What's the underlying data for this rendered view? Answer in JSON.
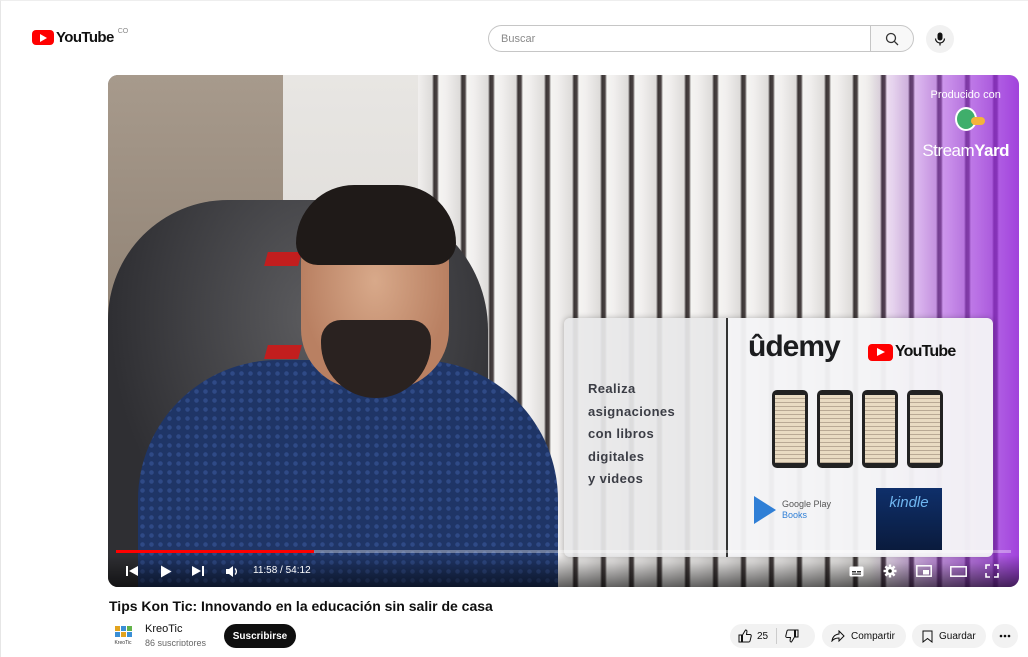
{
  "header": {
    "logo_text": "YouTube",
    "logo_country": "CO",
    "search_placeholder": "Buscar"
  },
  "video_frame": {
    "overlay_text_lines": [
      "Realiza",
      "asignaciones",
      "con libros",
      "digitales",
      "y videos"
    ],
    "brand_udemy": "ûdemy",
    "brand_youtube": "YouTube",
    "google_play_line1": "Google Play",
    "google_play_line2": "Books",
    "kindle": "kindle",
    "streamyard_produced": "Producido con",
    "streamyard_name_a": "Stream",
    "streamyard_name_b": "Yard"
  },
  "player": {
    "current_time": "11:58",
    "duration": "54:12",
    "time_display": "11:58 / 54:12",
    "progress_fraction": 0.221
  },
  "video": {
    "title": "Tips Kon Tic: Innovando en la educación sin salir de casa",
    "channel_name": "KreoTic",
    "channel_subs": "86 suscriptores",
    "avatar_label": "KreoTic",
    "subscribe_label": "Suscribirse",
    "likes": "25",
    "share_label": "Compartir",
    "save_label": "Guardar"
  },
  "colors": {
    "brand_red": "#ff0000",
    "subscribe_bg": "#0f0f0f",
    "pill_bg": "#f2f2f2"
  }
}
